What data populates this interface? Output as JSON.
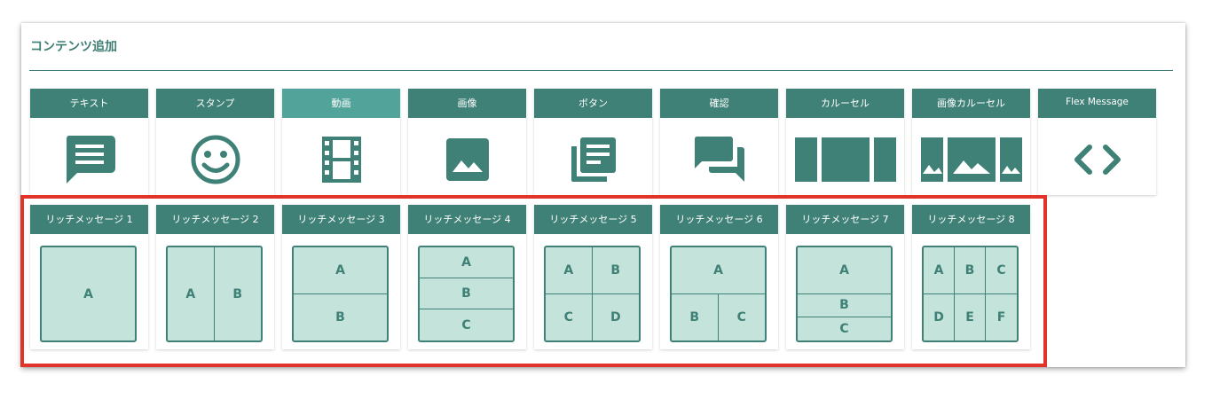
{
  "title": "コンテンツ追加",
  "colors": {
    "accent": "#3f8176",
    "accent_active": "#52a39a",
    "cell_fill": "#c3e3db",
    "highlight": "#e2332a"
  },
  "content_types": [
    {
      "label": "テキスト",
      "icon": "chat-bubble-icon"
    },
    {
      "label": "スタンプ",
      "icon": "smiley-icon"
    },
    {
      "label": "動画",
      "icon": "film-icon",
      "active": true
    },
    {
      "label": "画像",
      "icon": "image-icon"
    },
    {
      "label": "ボタン",
      "icon": "library-books-icon"
    },
    {
      "label": "確認",
      "icon": "forum-icon"
    },
    {
      "label": "カルーセル",
      "icon": "carousel-icon"
    },
    {
      "label": "画像カルーセル",
      "icon": "image-carousel-icon"
    },
    {
      "label": "Flex Message",
      "icon": "code-brackets-icon"
    }
  ],
  "rich_messages": [
    {
      "label": "リッチメッセージ 1",
      "cells": [
        "A"
      ]
    },
    {
      "label": "リッチメッセージ 2",
      "cells": [
        "A",
        "B"
      ]
    },
    {
      "label": "リッチメッセージ 3",
      "cells": [
        "A",
        "B"
      ]
    },
    {
      "label": "リッチメッセージ 4",
      "cells": [
        "A",
        "B",
        "C"
      ]
    },
    {
      "label": "リッチメッセージ 5",
      "cells": [
        "A",
        "B",
        "C",
        "D"
      ]
    },
    {
      "label": "リッチメッセージ 6",
      "cells": [
        "A",
        "B",
        "C"
      ]
    },
    {
      "label": "リッチメッセージ 7",
      "cells": [
        "A",
        "B",
        "C"
      ]
    },
    {
      "label": "リッチメッセージ 8",
      "cells": [
        "A",
        "B",
        "C",
        "D",
        "E",
        "F"
      ]
    }
  ]
}
